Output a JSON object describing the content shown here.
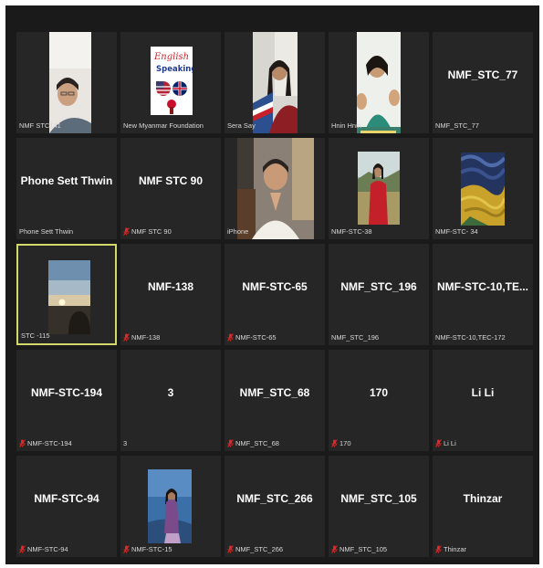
{
  "tiles": [
    {
      "name": "NMF STC141",
      "display": "",
      "muted": false,
      "video": "woman-glasses"
    },
    {
      "name": "New Myanmar Foundation",
      "display": "",
      "muted": false,
      "video": "english-speaking-logo",
      "logo_line1": "English",
      "logo_line2": "Speaking"
    },
    {
      "name": "Sera Say",
      "display": "",
      "muted": false,
      "video": "woman-flag"
    },
    {
      "name": "Hnin Hnin",
      "display": "",
      "muted": false,
      "video": "woman-waving"
    },
    {
      "name": "NMF_STC_77",
      "display": "NMF_STC_77",
      "muted": false,
      "video": ""
    },
    {
      "name": "Phone Sett Thwin",
      "display": "Phone Sett Thwin",
      "muted": false,
      "video": ""
    },
    {
      "name": "NMF STC 90",
      "display": "NMF STC 90",
      "muted": true,
      "video": ""
    },
    {
      "name": "iPhone",
      "display": "",
      "muted": false,
      "video": "woman-praying"
    },
    {
      "name": "NMF-STC-38",
      "display": "",
      "muted": false,
      "video": "woman-red-shirt"
    },
    {
      "name": "NMF-STC- 34",
      "display": "",
      "muted": false,
      "video": "wheatfield-painting"
    },
    {
      "name": "STC -115",
      "display": "",
      "muted": false,
      "video": "sunset-photo"
    },
    {
      "name": "NMF-138",
      "display": "NMF-138",
      "muted": true,
      "video": ""
    },
    {
      "name": "NMF-STC-65",
      "display": "NMF-STC-65",
      "muted": true,
      "video": ""
    },
    {
      "name": "NMF_STC_196",
      "display": "NMF_STC_196",
      "muted": false,
      "video": ""
    },
    {
      "name": "NMF-STC-10,TEC-172",
      "display": "NMF-STC-10,TE...",
      "muted": false,
      "video": ""
    },
    {
      "name": "NMF-STC-194",
      "display": "NMF-STC-194",
      "muted": true,
      "video": ""
    },
    {
      "name": "3",
      "display": "3",
      "muted": false,
      "video": ""
    },
    {
      "name": "NMF_STC_68",
      "display": "NMF_STC_68",
      "muted": true,
      "video": ""
    },
    {
      "name": "170",
      "display": "170",
      "muted": true,
      "video": ""
    },
    {
      "name": "Li Li",
      "display": "Li Li",
      "muted": true,
      "video": ""
    },
    {
      "name": "NMF-STC-94",
      "display": "NMF-STC-94",
      "muted": true,
      "video": ""
    },
    {
      "name": "NMF-STC-15",
      "display": "",
      "muted": true,
      "video": "woman-blue-photo"
    },
    {
      "name": "NMF_STC_266",
      "display": "NMF_STC_266",
      "muted": true,
      "video": ""
    },
    {
      "name": "NMF_STC_105",
      "display": "NMF_STC_105",
      "muted": true,
      "video": ""
    },
    {
      "name": "Thinzar",
      "display": "Thinzar",
      "muted": true,
      "video": ""
    }
  ],
  "active_tile": "STC -115",
  "speaking_tile": "Hnin Hnin",
  "colors": {
    "background": "#1a1a1a",
    "tile": "#262626",
    "active_border": "#d3d86a",
    "muted_icon": "#e02828"
  }
}
